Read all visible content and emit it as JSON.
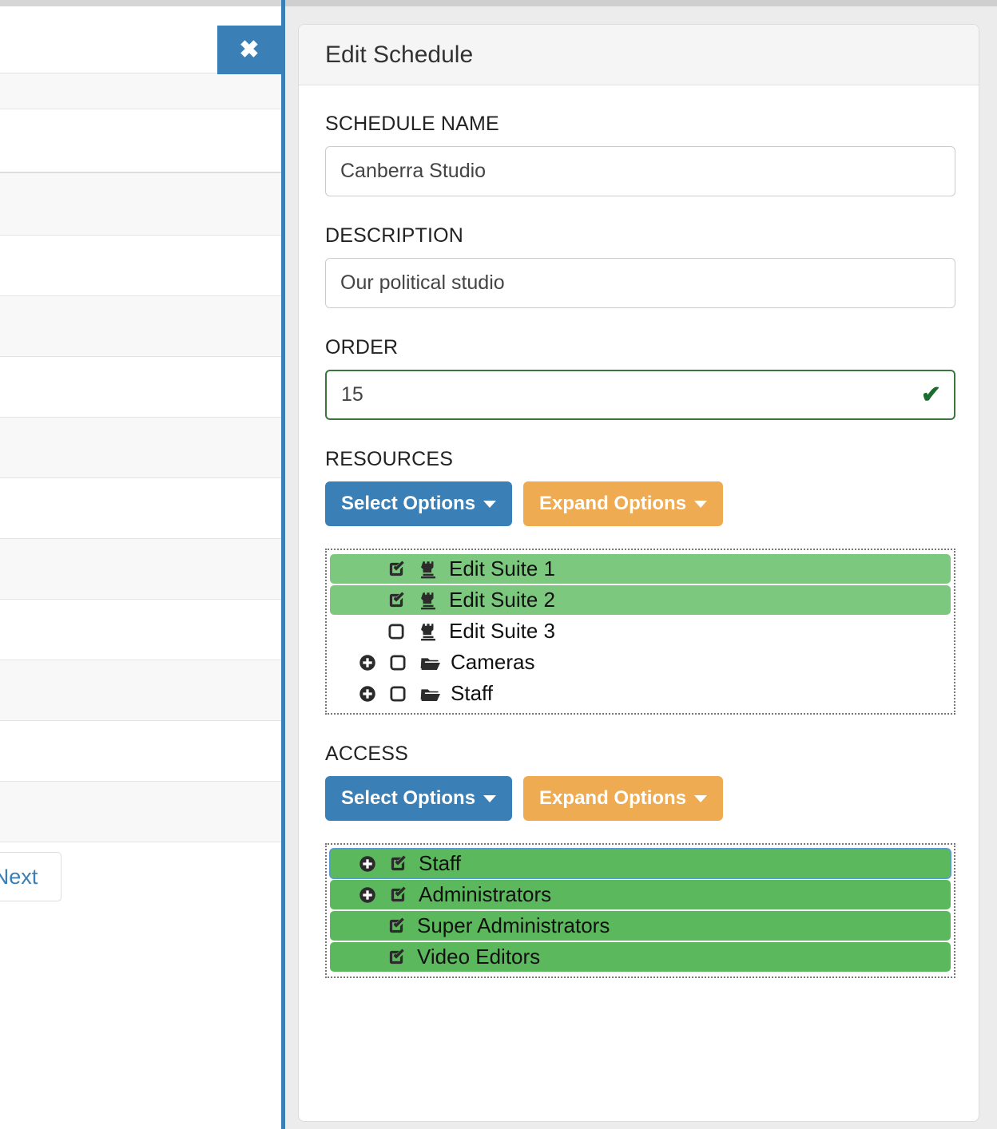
{
  "background": {
    "close_button_icon": "close-x-icon",
    "close_button_label": "✖",
    "pagination_next_label": "Next",
    "row_count": 12
  },
  "modal": {
    "title": "Edit Schedule",
    "fields": {
      "schedule_name": {
        "label": "SCHEDULE NAME",
        "value": "Canberra Studio",
        "placeholder": ""
      },
      "description": {
        "label": "DESCRIPTION",
        "value": "Our political studio",
        "placeholder": ""
      },
      "order": {
        "label": "ORDER",
        "value": "15",
        "placeholder": "",
        "valid": true,
        "valid_icon": "check-icon",
        "valid_glyph": "✔"
      }
    },
    "resources": {
      "label": "RESOURCES",
      "select_options_label": "Select Options",
      "expand_options_label": "Expand Options",
      "items": [
        {
          "label": "Edit Suite 1",
          "checked": true,
          "icon": "rook-icon",
          "expander": false,
          "indent": 1,
          "selected": true
        },
        {
          "label": "Edit Suite 2",
          "checked": true,
          "icon": "rook-icon",
          "expander": false,
          "indent": 1,
          "selected": true
        },
        {
          "label": "Edit Suite 3",
          "checked": false,
          "icon": "rook-icon",
          "expander": false,
          "indent": 1,
          "selected": false
        },
        {
          "label": "Cameras",
          "checked": false,
          "icon": "folder-icon",
          "expander": true,
          "indent": 0,
          "selected": false
        },
        {
          "label": "Staff",
          "checked": false,
          "icon": "folder-icon",
          "expander": true,
          "indent": 0,
          "selected": false
        }
      ]
    },
    "access": {
      "label": "ACCESS",
      "select_options_label": "Select Options",
      "expand_options_label": "Expand Options",
      "items": [
        {
          "label": "Staff",
          "checked": true,
          "expander": true,
          "indent": 0,
          "selected": true,
          "focused": true
        },
        {
          "label": "Administrators",
          "checked": true,
          "expander": true,
          "indent": 0,
          "selected": true,
          "focused": false
        },
        {
          "label": "Super Administrators",
          "checked": true,
          "expander": false,
          "indent": 1,
          "selected": true,
          "focused": false
        },
        {
          "label": "Video Editors",
          "checked": true,
          "expander": false,
          "indent": 1,
          "selected": true,
          "focused": false
        }
      ]
    }
  },
  "colors": {
    "primary_blue": "#3a7fb5",
    "warning_orange": "#efab51",
    "resource_green": "#7dc87f",
    "access_green": "#5cb85c",
    "valid_green": "#3c763d"
  }
}
